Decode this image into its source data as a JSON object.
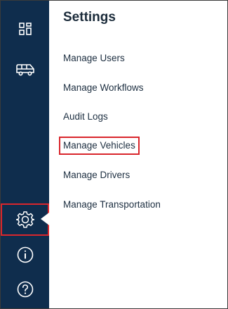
{
  "sidebar": {
    "items": [
      {
        "icon": "dashboard-icon",
        "active": false
      },
      {
        "icon": "van-icon",
        "active": false
      },
      {
        "icon": "gear-icon",
        "active": true
      },
      {
        "icon": "info-icon",
        "active": false
      },
      {
        "icon": "help-icon",
        "active": false
      }
    ]
  },
  "panel": {
    "title": "Settings",
    "menu": [
      {
        "label": "Manage Users"
      },
      {
        "label": "Manage Workflows"
      },
      {
        "label": "Audit Logs"
      },
      {
        "label": "Manage Vehicles",
        "highlighted": true
      },
      {
        "label": "Manage Drivers"
      },
      {
        "label": "Manage Transportation"
      }
    ]
  },
  "colors": {
    "sidebar_bg": "#0f2d4d",
    "highlight_border": "#d9262c",
    "text": "#1c2e40"
  }
}
